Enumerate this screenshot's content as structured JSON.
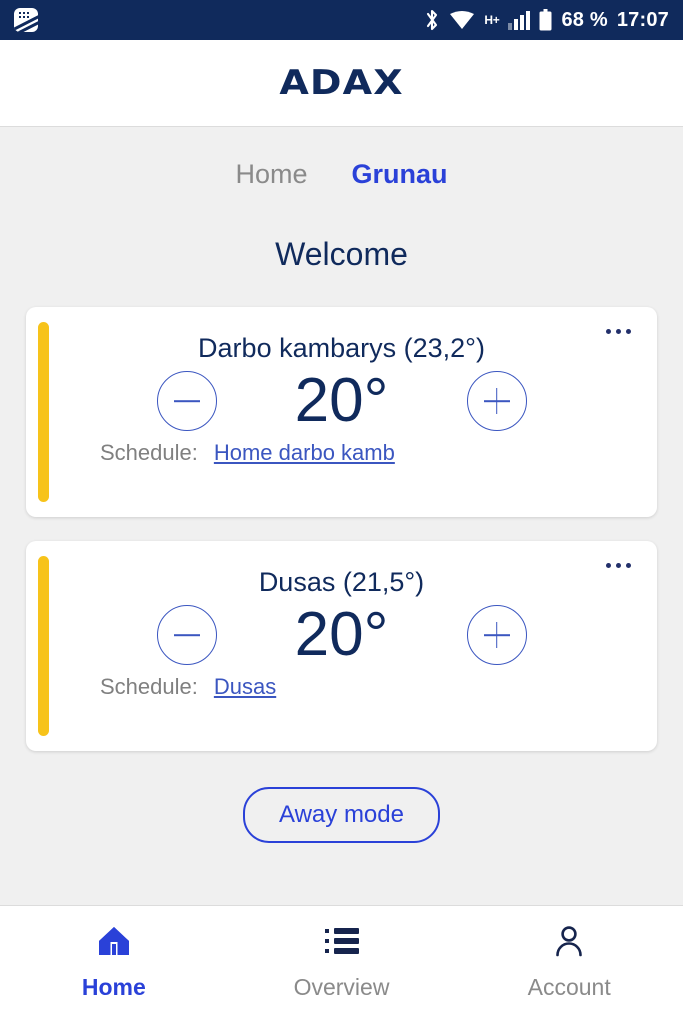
{
  "status_bar": {
    "notification_icon": "app-notification-icon",
    "bluetooth_icon": "bluetooth-icon",
    "wifi_icon": "wifi-icon",
    "network_type": "H+",
    "signal_icon": "cellular-signal-icon",
    "battery_icon": "battery-icon",
    "battery_percent": "68 %",
    "time": "17:07",
    "background_color": "#102a5c"
  },
  "header": {
    "logo_text": "ADAX",
    "logo_color": "#102a5c"
  },
  "section_tabs": [
    {
      "label": "Home",
      "active": false
    },
    {
      "label": "Grunau",
      "active": true
    }
  ],
  "main": {
    "welcome_title": "Welcome",
    "accent_color": "#f7c31a",
    "primary_blue": "#2a41d8",
    "navy": "#102a5c",
    "rooms": [
      {
        "title": "Darbo kambarys (23,2°)",
        "name": "Darbo kambarys",
        "current_temperature": "23,2°",
        "setpoint": "20°",
        "decrease_label": "−",
        "increase_label": "+",
        "schedule_label": "Schedule:",
        "schedule_name": "Home darbo kamb",
        "menu_icon": "more-options-icon"
      },
      {
        "title": "Dusas (21,5°)",
        "name": "Dusas",
        "current_temperature": "21,5°",
        "setpoint": "20°",
        "decrease_label": "−",
        "increase_label": "+",
        "schedule_label": "Schedule:",
        "schedule_name": "Dusas",
        "menu_icon": "more-options-icon"
      }
    ],
    "away_mode_label": "Away mode"
  },
  "bottom_nav": [
    {
      "label": "Home",
      "icon": "home-icon",
      "active": true
    },
    {
      "label": "Overview",
      "icon": "list-icon",
      "active": false
    },
    {
      "label": "Account",
      "icon": "person-icon",
      "active": false
    }
  ]
}
